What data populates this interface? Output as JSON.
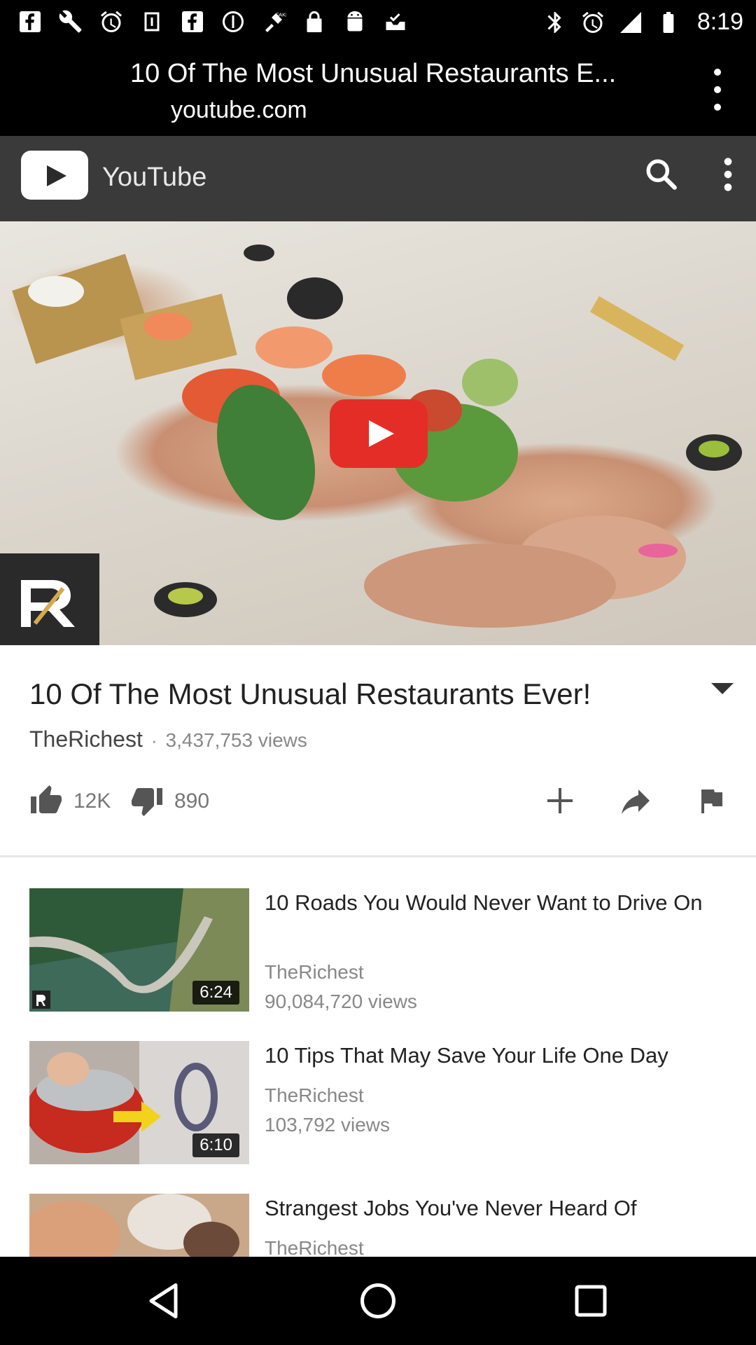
{
  "status_bar": {
    "time": "8:19",
    "icons": [
      "facebook-icon",
      "wrench-icon",
      "alarm-icon",
      "tv-icon",
      "facebook-icon",
      "circle-icon",
      "fake-gps-icon",
      "lock-icon",
      "android-icon",
      "inbox-check-icon",
      "bluetooth-icon",
      "alarm-icon",
      "signal-icon",
      "battery-icon"
    ]
  },
  "custom_tab": {
    "title": "10 Of The Most Unusual Restaurants E...",
    "url": "youtube.com"
  },
  "yt_header": {
    "brand": "YouTube"
  },
  "video": {
    "title": "10 Of The Most Unusual Restaurants Ever!",
    "channel": "TheRichest",
    "separator": "·",
    "views": "3,437,753 views",
    "likes": "12K",
    "dislikes": "890"
  },
  "related": [
    {
      "title": "10 Roads You Would Never Want to Drive On",
      "channel": "TheRichest",
      "views": "90,084,720 views",
      "duration": "6:24"
    },
    {
      "title": "10 Tips That May Save Your Life One Day",
      "channel": "TheRichest",
      "views": "103,792 views",
      "duration": "6:10"
    },
    {
      "title": "Strangest Jobs You've Never Heard Of",
      "channel": "TheRichest"
    }
  ],
  "colors": {
    "youtube_red": "#e52d27",
    "header_bg": "#3a3a3a"
  }
}
